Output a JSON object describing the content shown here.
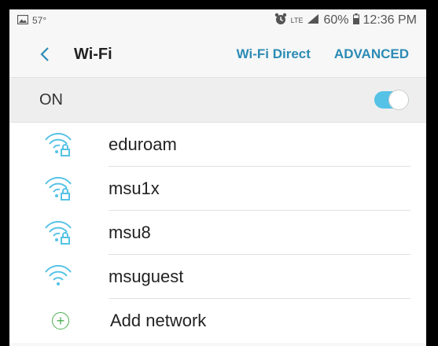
{
  "status_bar": {
    "temperature": "57°",
    "network_type": "LTE",
    "battery": "60%",
    "time": "12:36 PM",
    "icons": [
      "image-icon",
      "alarm-icon",
      "signal-icon",
      "battery-icon"
    ]
  },
  "header": {
    "title": "Wi-Fi",
    "wifi_direct_label": "Wi-Fi Direct",
    "advanced_label": "ADVANCED"
  },
  "wifi_toggle": {
    "label": "ON",
    "enabled": true,
    "color": "#55c2e6"
  },
  "networks": [
    {
      "name": "eduroam",
      "secured": true
    },
    {
      "name": "msu1x",
      "secured": true
    },
    {
      "name": "msu8",
      "secured": true
    },
    {
      "name": "msuguest",
      "secured": false
    }
  ],
  "add_network": {
    "label": "Add network",
    "icon": "plus-icon"
  },
  "colors": {
    "accent": "#2c8bb5",
    "wifi_icon": "#55c2e6",
    "add_icon": "#4caf50"
  }
}
